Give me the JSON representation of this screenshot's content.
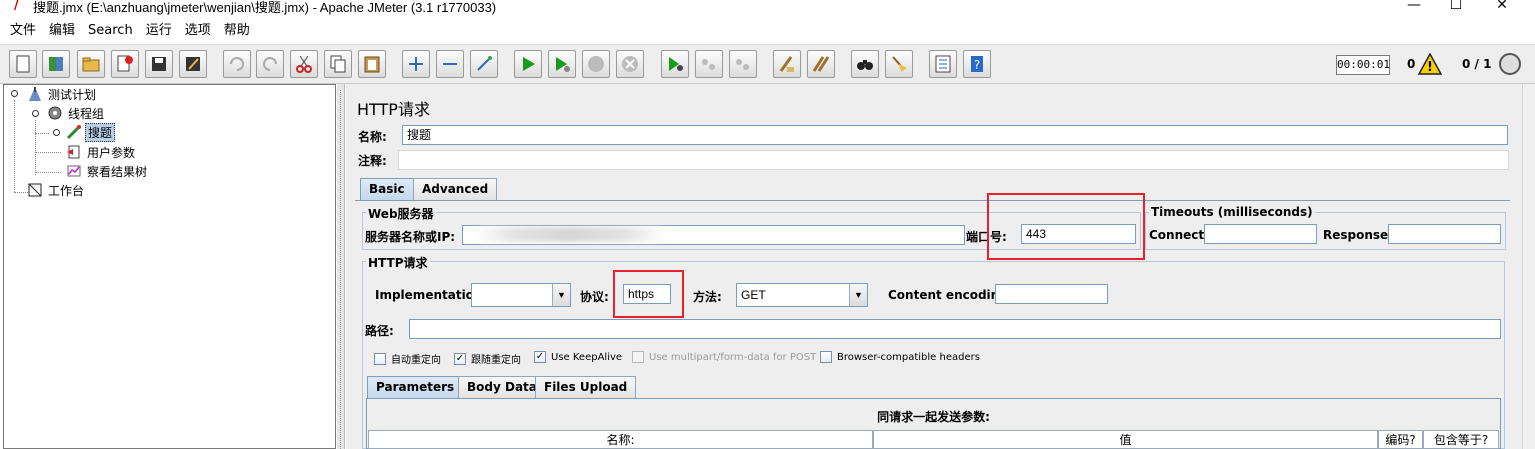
{
  "window": {
    "title": "搜题.jmx (E:\\anzhuang\\jmeter\\wenjian\\搜题.jmx) - Apache JMeter (3.1 r1770033)",
    "minimize": "—",
    "maximize": "☐",
    "close": "✕"
  },
  "menu": [
    "文件",
    "编辑",
    "Search",
    "运行",
    "选项",
    "帮助"
  ],
  "toolbar": {
    "buttons": [
      "new-icon",
      "templates-icon",
      "open-icon",
      "close-icon",
      "save-icon",
      "save-as-icon",
      "undo-icon",
      "redo-icon",
      "cut-icon",
      "copy-icon",
      "paste-icon",
      "expand-icon",
      "collapse-icon",
      "toggle-icon",
      "start-icon",
      "start-no-pause-icon",
      "stop-icon",
      "shutdown-icon",
      "remote-start-icon",
      "remote-stop-icon",
      "remote-shutdown-icon",
      "clear-icon",
      "clear-all-icon",
      "search-icon",
      "reset-search-icon",
      "function-helper-icon",
      "help-icon"
    ],
    "elapsed": "00:00:01",
    "warnings": "0",
    "threads": "0 / 1"
  },
  "tree": {
    "items": [
      {
        "label": "测试计划",
        "icon": "test-plan-icon"
      },
      {
        "label": "线程组",
        "icon": "thread-group-icon"
      },
      {
        "label": "搜题",
        "icon": "sampler-icon"
      },
      {
        "label": "用户参数",
        "icon": "preprocessor-icon"
      },
      {
        "label": "察看结果树",
        "icon": "listener-icon"
      },
      {
        "label": "工作台",
        "icon": "workbench-icon"
      }
    ]
  },
  "panel": {
    "title": "HTTP请求",
    "name_label": "名称:",
    "name_value": "搜题",
    "comment_label": "注释:",
    "comment_value": "",
    "tabs": [
      "Basic",
      "Advanced"
    ],
    "web_server": {
      "title": "Web服务器",
      "server_label": "服务器名称或IP:",
      "server_value": "",
      "port_label": "端口号:",
      "port_value": "443"
    },
    "timeouts": {
      "title": "Timeouts (milliseconds)",
      "connect_label": "Connect:",
      "connect_value": "",
      "response_label": "Response:",
      "response_value": ""
    },
    "http_request": {
      "title": "HTTP请求",
      "implementation_label": "Implementation:",
      "implementation_value": "",
      "protocol_label": "协议:",
      "protocol_value": "https",
      "method_label": "方法:",
      "method_value": "GET",
      "encoding_label": "Content encoding:",
      "encoding_value": "",
      "path_label": "路径:",
      "path_value": ""
    },
    "checkboxes": [
      {
        "label": "自动重定向",
        "checked": false,
        "disabled": false
      },
      {
        "label": "跟随重定向",
        "checked": true,
        "disabled": false
      },
      {
        "label": "Use KeepAlive",
        "checked": true,
        "disabled": false
      },
      {
        "label": "Use multipart/form-data for POST",
        "checked": false,
        "disabled": true
      },
      {
        "label": "Browser-compatible headers",
        "checked": false,
        "disabled": false
      }
    ],
    "sub_tabs": [
      "Parameters",
      "Body Data",
      "Files Upload"
    ],
    "params_caption": "同请求一起发送参数:",
    "params_columns": [
      "名称:",
      "值",
      "编码?",
      "包含等于?"
    ]
  },
  "colors": {
    "highlight_box": "#e8222a",
    "selection": "#b8cfe5",
    "tab_active": "#c5d8ec"
  }
}
